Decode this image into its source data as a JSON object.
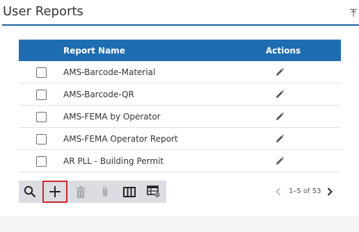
{
  "panel": {
    "title": "User Reports"
  },
  "table": {
    "columns": [
      "Report Name",
      "Actions"
    ],
    "rows": [
      {
        "name": "AMS-Barcode-Material",
        "action_icon": "pencil-icon"
      },
      {
        "name": "AMS-Barcode-QR",
        "action_icon": "pencil-icon"
      },
      {
        "name": "AMS-FEMA by Operator",
        "action_icon": "pencil-icon"
      },
      {
        "name": "AMS-FEMA Operator Report",
        "action_icon": "pencil-icon"
      },
      {
        "name": "AR PLL - Building Permit",
        "action_icon": "pencil-icon"
      }
    ]
  },
  "toolbar": {
    "buttons": [
      {
        "icon": "search-icon",
        "enabled": true
      },
      {
        "icon": "plus-icon",
        "enabled": true,
        "selected": true
      },
      {
        "icon": "trash-icon",
        "enabled": false
      },
      {
        "icon": "paperclip-icon",
        "enabled": false
      },
      {
        "icon": "columns-icon",
        "enabled": true
      },
      {
        "icon": "table-settings-icon",
        "enabled": true
      }
    ]
  },
  "pagination": {
    "range_text": "1–5 of 53",
    "prev_enabled": false,
    "next_enabled": true
  },
  "colors": {
    "header_bg": "#1f6db1",
    "title_rule": "#1b5fa0",
    "toolbar_bg": "#dcdde2",
    "selected_outline": "#c62828"
  }
}
